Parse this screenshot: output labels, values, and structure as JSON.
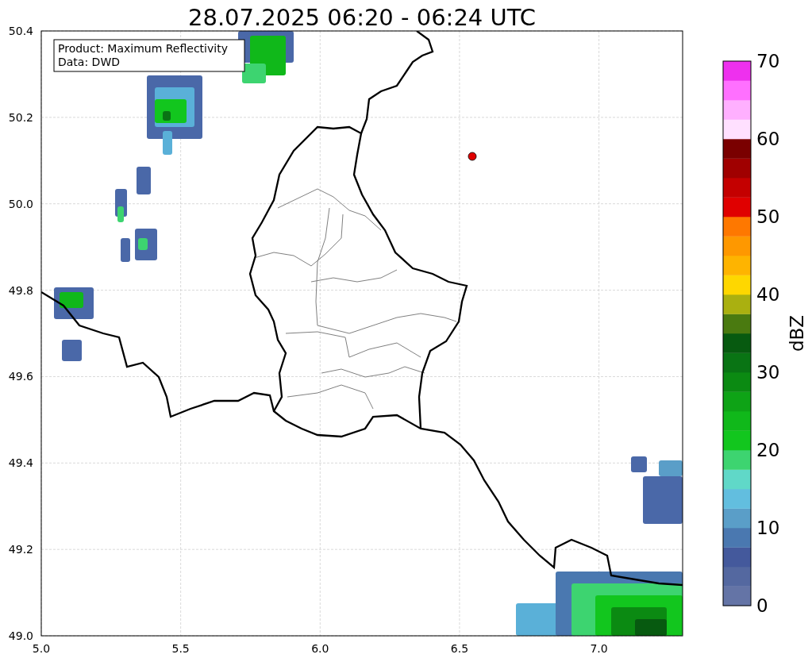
{
  "title": "28.07.2025 06:20 - 06:24 UTC",
  "legend": [
    "Product: Maximum Reflectivity",
    "Data: DWD"
  ],
  "map": {
    "xticks": [
      "5.0",
      "5.5",
      "6.0",
      "6.5",
      "7.0"
    ],
    "yticks": [
      "50.4",
      "50.2",
      "50.0",
      "49.8",
      "49.6",
      "49.4",
      "49.2",
      "49.0"
    ]
  },
  "colorbar": {
    "label": "dBZ",
    "ticks": [
      "70",
      "60",
      "50",
      "40",
      "30",
      "20",
      "10",
      "0"
    ],
    "bins": [
      {
        "color": "#6474a6"
      },
      {
        "color": "#5468a0"
      },
      {
        "color": "#44599c"
      },
      {
        "color": "#4a78b0"
      },
      {
        "color": "#5a9ec8"
      },
      {
        "color": "#62bedf"
      },
      {
        "color": "#60d8c8"
      },
      {
        "color": "#3dd470"
      },
      {
        "color": "#12c61e"
      },
      {
        "color": "#10b81a"
      },
      {
        "color": "#0ea316"
      },
      {
        "color": "#0b8a12"
      },
      {
        "color": "#097414"
      },
      {
        "color": "#075a10"
      },
      {
        "color": "#4a7a10"
      },
      {
        "color": "#aab010"
      },
      {
        "color": "#fed700"
      },
      {
        "color": "#feb400"
      },
      {
        "color": "#fe9800"
      },
      {
        "color": "#fe7800"
      },
      {
        "color": "#e00000"
      },
      {
        "color": "#c40000"
      },
      {
        "color": "#a00000"
      },
      {
        "color": "#7a0000"
      },
      {
        "color": "#ffe0ff"
      },
      {
        "color": "#ffb0ff"
      },
      {
        "color": "#ff70ff"
      },
      {
        "color": "#ee30ee"
      }
    ]
  }
}
